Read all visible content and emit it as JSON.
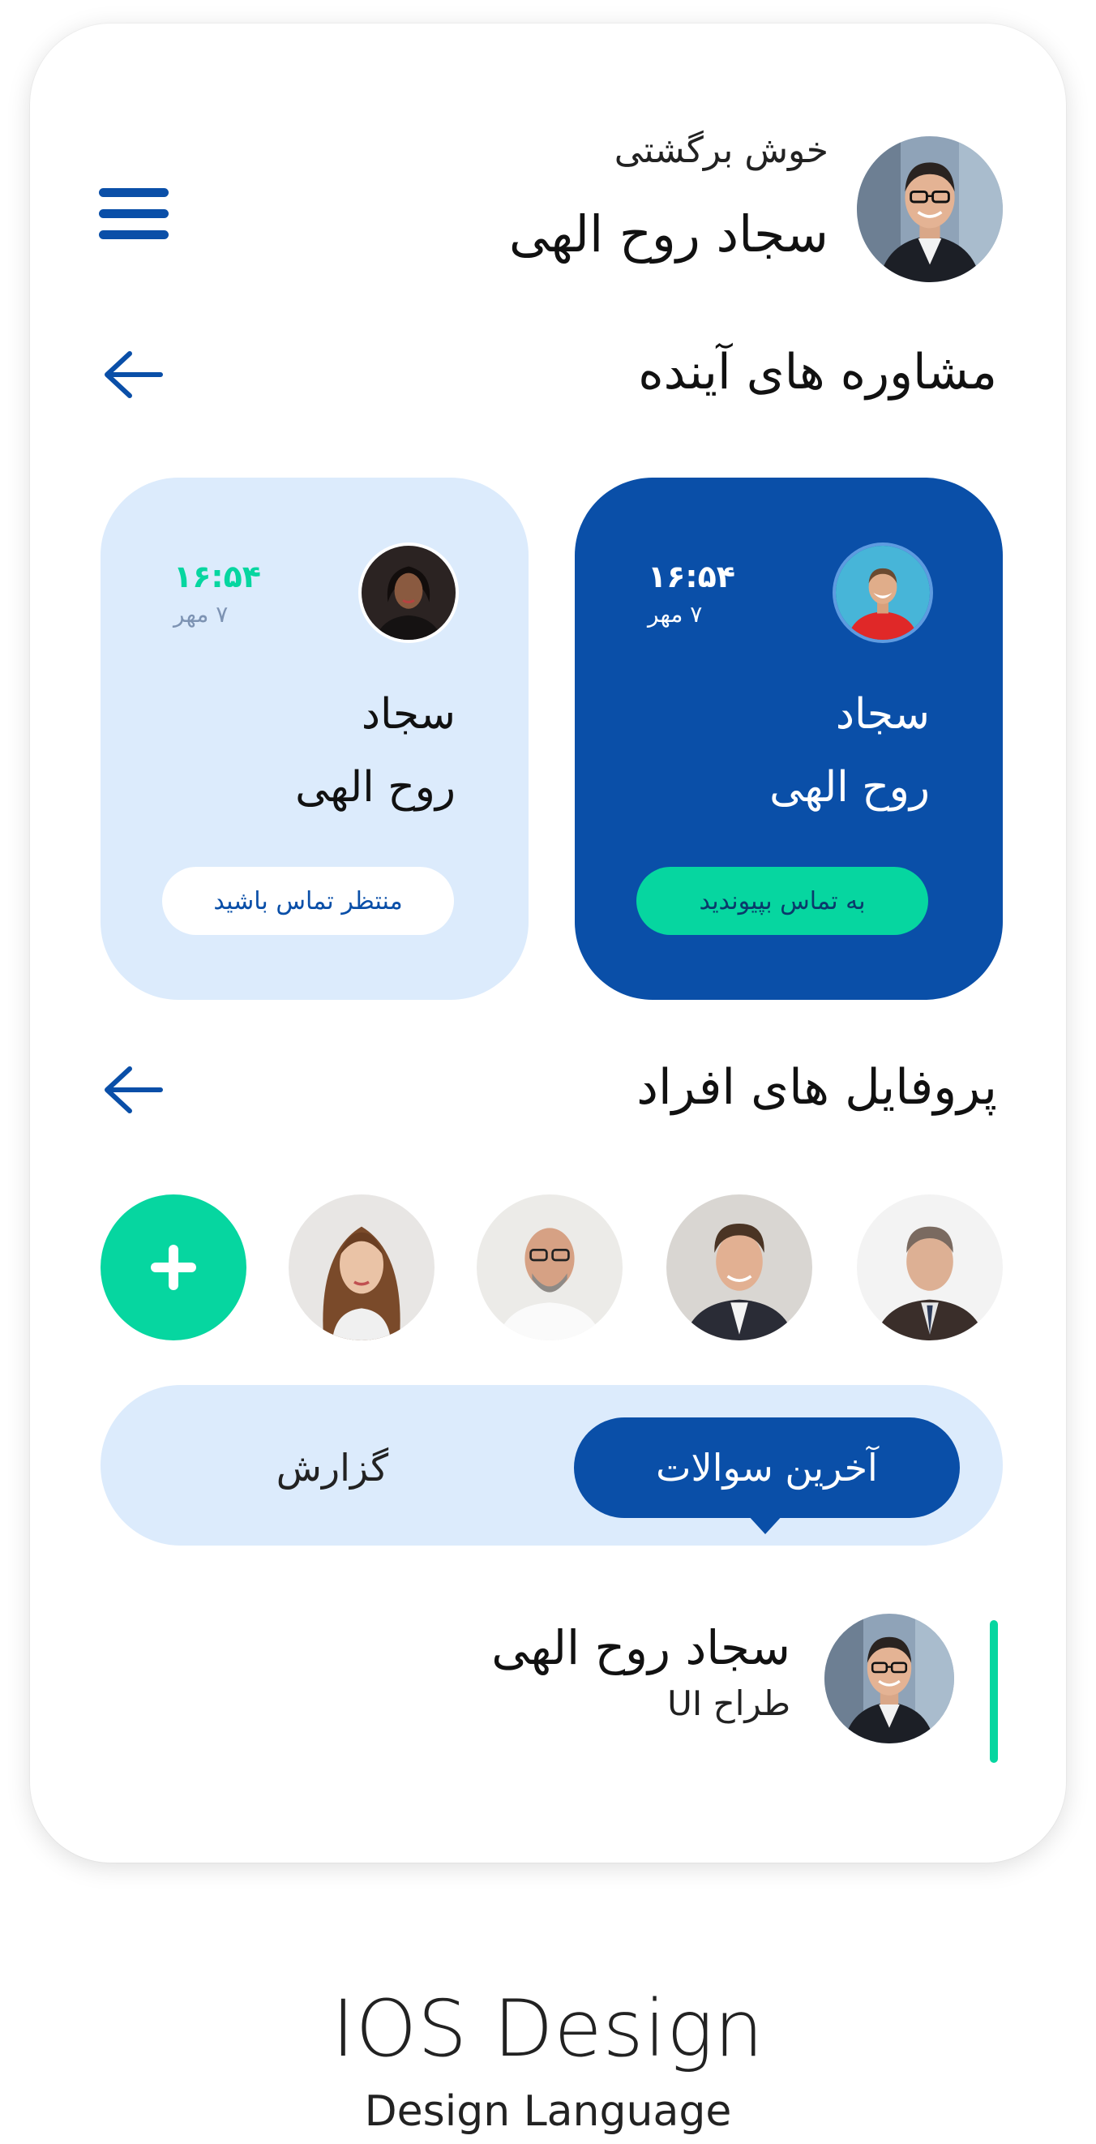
{
  "header": {
    "welcome": "خوش برگشتی",
    "user_name": "سجاد روح الهی"
  },
  "upcoming": {
    "title": "مشاوره های آینده",
    "cards": [
      {
        "time": "۱۶:۵۴",
        "date": "۷ مهر",
        "name_first": "سجاد",
        "name_last": "روح الهی",
        "button": "به تماس بپیوندید",
        "style": "primary"
      },
      {
        "time": "۱۶:۵۴",
        "date": "۷ مهر",
        "name_first": "سجاد",
        "name_last": "روح الهی",
        "button": "منتظر تماس باشید",
        "style": "light"
      }
    ]
  },
  "profiles": {
    "title": "پروفایل های افراد"
  },
  "tabs": [
    {
      "label": "آخرین سوالات",
      "active": true
    },
    {
      "label": "گزارش",
      "active": false
    }
  ],
  "list": [
    {
      "name": "سجاد روح الهی",
      "role": "طراح UI"
    }
  ],
  "footer": {
    "title": "IOS Design",
    "subtitle": "Design Language"
  },
  "colors": {
    "primary": "#0a4fa8",
    "accent": "#06d6a0",
    "light": "#dcebfc"
  }
}
